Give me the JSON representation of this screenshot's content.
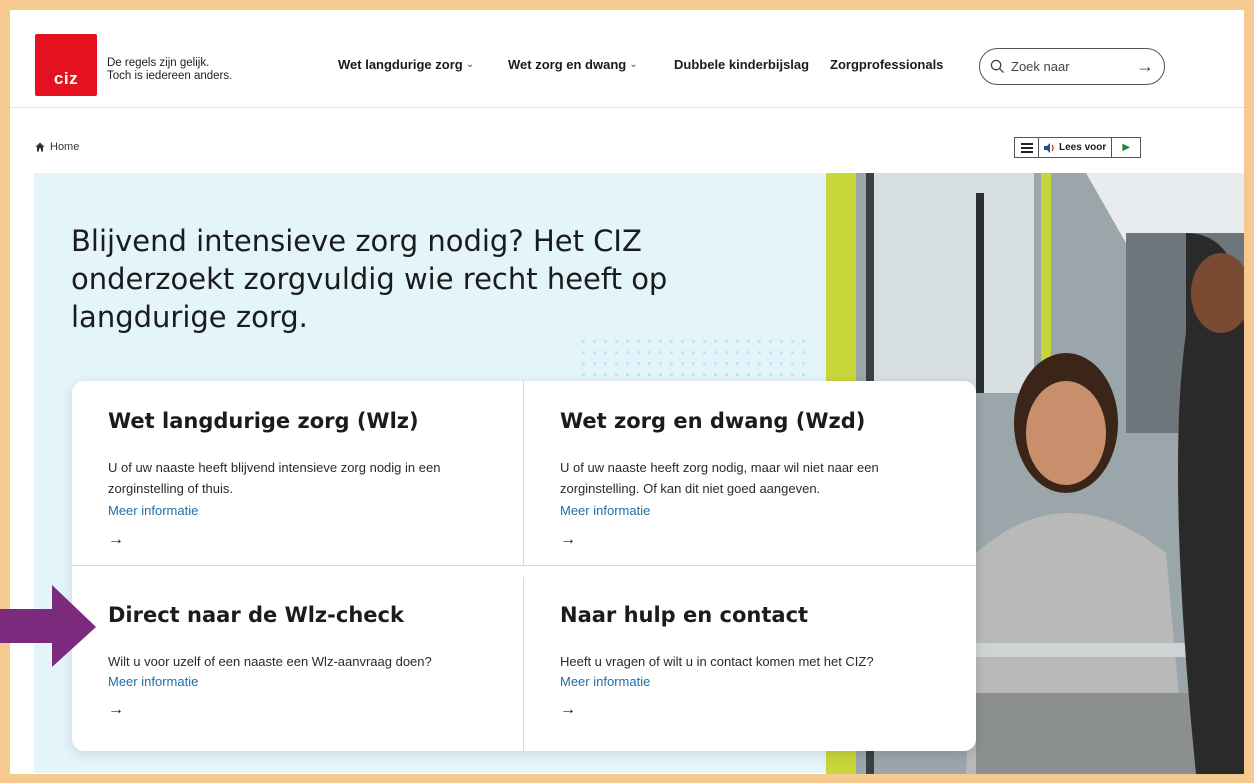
{
  "header": {
    "logo_text": "ciz",
    "tagline_line1": "De regels zijn gelijk.",
    "tagline_line2": "Toch is iedereen anders.",
    "nav": [
      {
        "label": "Wet langdurige zorg",
        "has_dropdown": true
      },
      {
        "label": "Wet zorg en dwang",
        "has_dropdown": true
      },
      {
        "label": "Dubbele kinderbijslag",
        "has_dropdown": false
      },
      {
        "label": "Zorgprofessionals",
        "has_dropdown": false
      }
    ],
    "search": {
      "placeholder": "Zoek naar",
      "value": ""
    }
  },
  "breadcrumb": {
    "home_label": "Home"
  },
  "readspeaker": {
    "label": "Lees voor"
  },
  "hero": {
    "title": "Blijvend intensieve zorg nodig? Het CIZ onderzoekt zorgvuldig wie recht heeft op langdurige zorg."
  },
  "cards": [
    {
      "title": "Wet langdurige zorg (Wlz)",
      "description": "U of uw naaste heeft blijvend intensieve zorg nodig in een zorginstelling of thuis.",
      "link": "Meer informatie"
    },
    {
      "title": "Wet zorg en dwang (Wzd)",
      "description": "U of uw naaste heeft zorg nodig, maar wil niet naar een zorginstelling. Of kan dit niet goed aangeven.",
      "link": "Meer informatie"
    },
    {
      "title": "Direct naar de Wlz-check",
      "description": "Wilt u voor uzelf of een naaste een Wlz-aanvraag doen?",
      "link": "Meer informatie"
    },
    {
      "title": "Naar hulp en contact",
      "description": "Heeft u vragen of wilt u in contact komen met het CIZ?",
      "link": "Meer informatie"
    }
  ],
  "colors": {
    "brand_red": "#e4121e",
    "hero_bg": "#e4f4fb",
    "link_blue": "#1f6fa5",
    "frame_border": "#f5c98f",
    "annotation_arrow": "#7b2a7d"
  }
}
